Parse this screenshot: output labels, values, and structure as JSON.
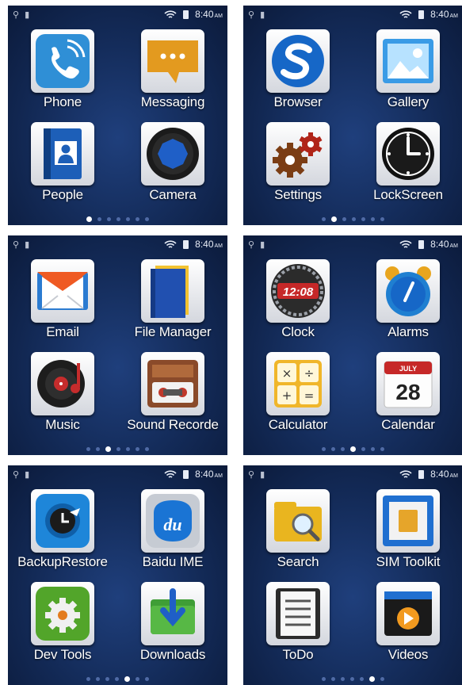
{
  "status_bar": {
    "time": "8:40",
    "ampm": "AM"
  },
  "screens": [
    {
      "apps": [
        {
          "label": "Phone",
          "icon": "phone-icon"
        },
        {
          "label": "Messaging",
          "icon": "messaging-icon"
        },
        {
          "label": "People",
          "icon": "people-icon"
        },
        {
          "label": "Camera",
          "icon": "camera-icon"
        }
      ],
      "page_count": 7,
      "active_page": 0
    },
    {
      "apps": [
        {
          "label": "Browser",
          "icon": "browser-icon"
        },
        {
          "label": "Gallery",
          "icon": "gallery-icon"
        },
        {
          "label": "Settings",
          "icon": "settings-icon"
        },
        {
          "label": "LockScreen",
          "icon": "lockscreen-icon"
        }
      ],
      "page_count": 7,
      "active_page": 1
    },
    {
      "apps": [
        {
          "label": "Email",
          "icon": "email-icon"
        },
        {
          "label": "File Manager",
          "icon": "file-manager-icon"
        },
        {
          "label": "Music",
          "icon": "music-icon"
        },
        {
          "label": "Sound Recorde",
          "icon": "sound-recorder-icon"
        }
      ],
      "page_count": 7,
      "active_page": 2
    },
    {
      "apps": [
        {
          "label": "Clock",
          "icon": "clock-icon",
          "text": "12:08"
        },
        {
          "label": "Alarms",
          "icon": "alarms-icon"
        },
        {
          "label": "Calculator",
          "icon": "calculator-icon"
        },
        {
          "label": "Calendar",
          "icon": "calendar-icon",
          "month": "JULY",
          "day": "28"
        }
      ],
      "page_count": 7,
      "active_page": 3
    },
    {
      "apps": [
        {
          "label": "BackupRestore",
          "icon": "backup-restore-icon"
        },
        {
          "label": "Baidu IME",
          "icon": "baidu-ime-icon",
          "text": "du"
        },
        {
          "label": "Dev Tools",
          "icon": "dev-tools-icon"
        },
        {
          "label": "Downloads",
          "icon": "downloads-icon"
        }
      ],
      "page_count": 7,
      "active_page": 4
    },
    {
      "apps": [
        {
          "label": "Search",
          "icon": "search-icon"
        },
        {
          "label": "SIM Toolkit",
          "icon": "sim-toolkit-icon"
        },
        {
          "label": "ToDo",
          "icon": "todo-icon"
        },
        {
          "label": "Videos",
          "icon": "videos-icon"
        }
      ],
      "page_count": 7,
      "active_page": 5
    }
  ]
}
